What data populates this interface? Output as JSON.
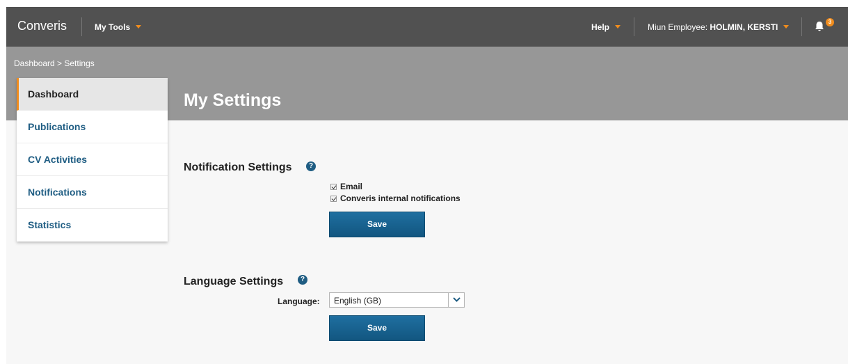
{
  "header": {
    "logo": "Converis",
    "my_tools": "My Tools",
    "help": "Help",
    "user_prefix": "Miun Employee: ",
    "user_name": "HOLMIN, KERSTI",
    "notification_count": "3"
  },
  "breadcrumb": "Dashboard > Settings",
  "page_title": "My Settings",
  "sidebar": {
    "items": [
      {
        "label": "Dashboard"
      },
      {
        "label": "Publications"
      },
      {
        "label": "CV Activities"
      },
      {
        "label": "Notifications"
      },
      {
        "label": "Statistics"
      }
    ]
  },
  "notification_settings": {
    "title": "Notification Settings",
    "help_symbol": "?",
    "options": [
      {
        "label": "Email",
        "checked": true
      },
      {
        "label": "Converis internal notifications",
        "checked": true
      }
    ],
    "save_label": "Save"
  },
  "language_settings": {
    "title": "Language Settings",
    "help_symbol": "?",
    "label": "Language:",
    "selected": "English (GB)",
    "save_label": "Save"
  },
  "colors": {
    "accent": "#f08c1d",
    "topbar": "#515151",
    "band": "#979797",
    "link": "#1f5d83",
    "button": "#1f6fa0"
  }
}
